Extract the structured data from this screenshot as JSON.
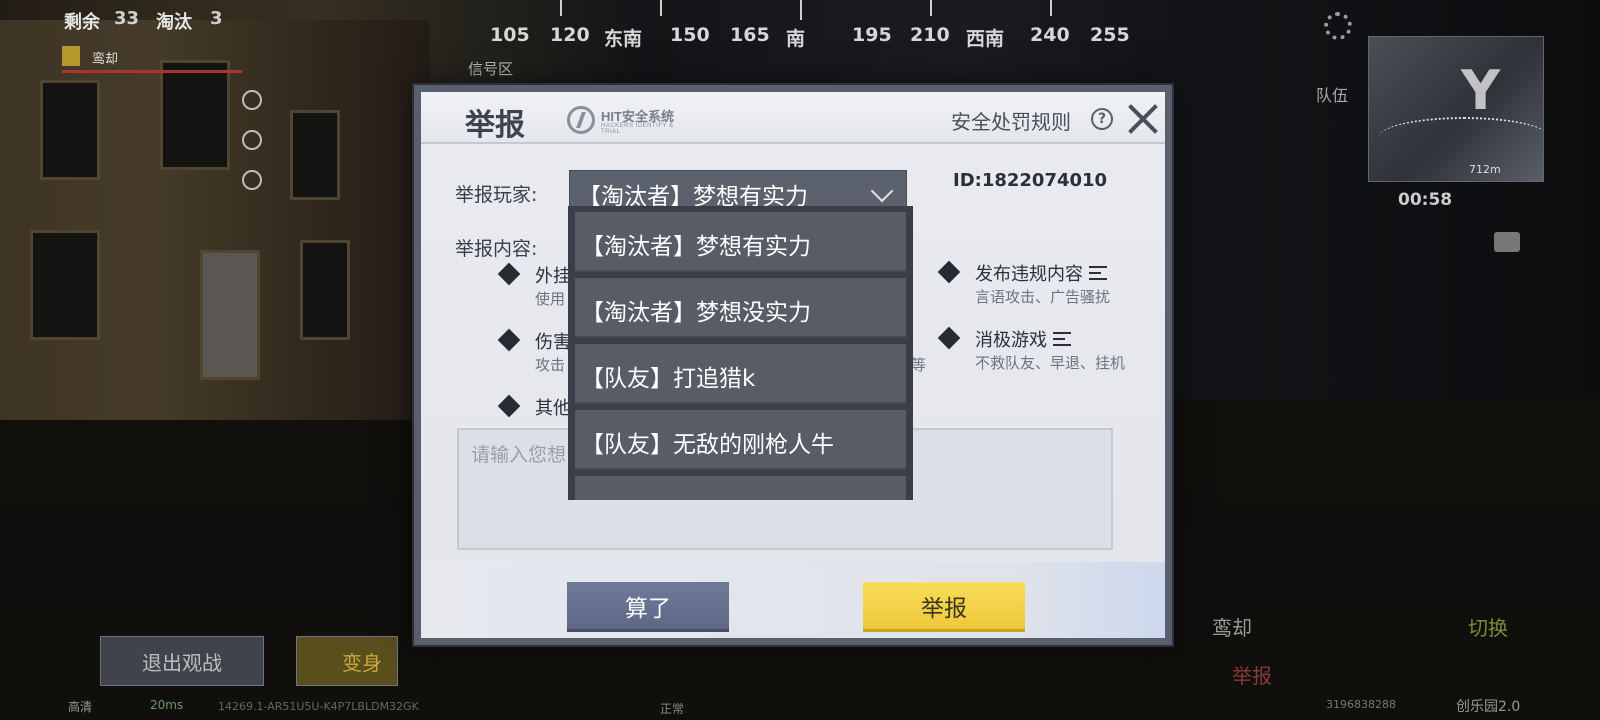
{
  "hud": {
    "remaining_label": "剩余",
    "remaining_count": "33",
    "eliminated_label": "淘汰",
    "eliminated_count": "3",
    "signal_zone": "信号区",
    "compass": [
      "105",
      "120",
      "东南",
      "150",
      "165",
      "南",
      "195",
      "210",
      "西南",
      "240",
      "255"
    ],
    "team_player_name": "鸾却",
    "team_label": "队伍",
    "map_distance": "712m",
    "timer": "00:58",
    "exit_spectate": "退出观战",
    "transform": "变身",
    "spectated_player": "鸾却",
    "switch": "切换",
    "report": "举报",
    "bottom_id": "3196838288",
    "creative_park": "创乐园2.0",
    "quality": "高清",
    "ping": "20ms",
    "build_id": "14269.1-AR51U5U-K4P7LBLDM32GK",
    "status": "正常"
  },
  "dialog": {
    "title": "举报",
    "brand_name": "HIT安全系统",
    "brand_sub": "HACKERS IDENTIFY & TRIAL",
    "rules_link": "安全处罚规则",
    "help_glyph": "?",
    "player_label": "举报玩家:",
    "selected_player": "【淘汰者】梦想有实力",
    "player_id": "ID:1822074010",
    "content_label": "举报内容:",
    "reasons": [
      {
        "title": "外挂",
        "desc": "使用"
      },
      {
        "title": "伤害",
        "desc": "攻击"
      },
      {
        "title": "其他",
        "desc": ""
      },
      {
        "title": "发布违规内容",
        "desc": "言语攻击、广告骚扰"
      },
      {
        "title": "消极游戏",
        "desc": "不救队友、早退、挂机"
      }
    ],
    "hidden_desc_tail": "等",
    "textarea_placeholder": "请输入您想",
    "cancel_button": "算了",
    "report_button": "举报"
  },
  "dropdown": {
    "options": [
      "【淘汰者】梦想有实力",
      "【淘汰者】梦想没实力",
      "【队友】打追猎k",
      "【队友】无敌的刚枪人牛"
    ]
  }
}
